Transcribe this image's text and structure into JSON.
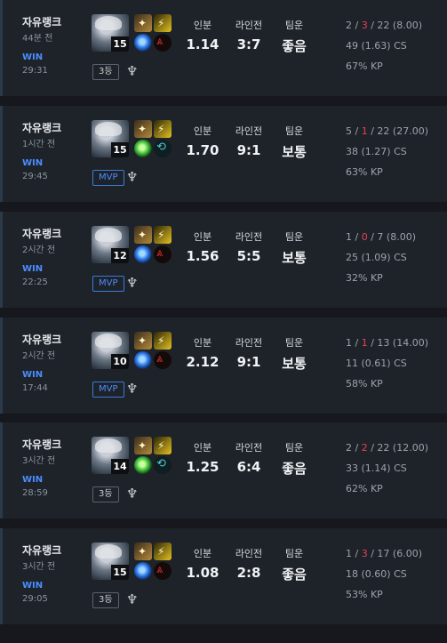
{
  "matches": [
    {
      "queue": "자유랭크",
      "ago": "44분 전",
      "result": "WIN",
      "duration": "29:31",
      "level": "15",
      "badge": "3등",
      "badge_type": "rank",
      "rune2": "red",
      "rune1": "blue",
      "stats": {
        "label1": "인분",
        "value1": "1.14",
        "label2": "라인전",
        "value2": "3:7",
        "label3": "팀운",
        "value3": "좋음"
      },
      "kda": {
        "k": "2",
        "d": "3",
        "a": "22",
        "ratio": "(8.00)"
      },
      "cs": "49 (1.63) CS",
      "kp": "67% KP"
    },
    {
      "queue": "자유랭크",
      "ago": "1시간 전",
      "result": "WIN",
      "duration": "29:45",
      "level": "15",
      "badge": "MVP",
      "badge_type": "mvp",
      "rune2": "teal",
      "rune1": "green",
      "stats": {
        "label1": "인분",
        "value1": "1.70",
        "label2": "라인전",
        "value2": "9:1",
        "label3": "팀운",
        "value3": "보통"
      },
      "kda": {
        "k": "5",
        "d": "1",
        "a": "22",
        "ratio": "(27.00)"
      },
      "cs": "38 (1.27) CS",
      "kp": "63% KP"
    },
    {
      "queue": "자유랭크",
      "ago": "2시간 전",
      "result": "WIN",
      "duration": "22:25",
      "level": "12",
      "badge": "MVP",
      "badge_type": "mvp",
      "rune2": "red",
      "rune1": "blue",
      "stats": {
        "label1": "인분",
        "value1": "1.56",
        "label2": "라인전",
        "value2": "5:5",
        "label3": "팀운",
        "value3": "보통"
      },
      "kda": {
        "k": "1",
        "d": "0",
        "a": "7",
        "ratio": "(8.00)"
      },
      "cs": "25 (1.09) CS",
      "kp": "32% KP"
    },
    {
      "queue": "자유랭크",
      "ago": "2시간 전",
      "result": "WIN",
      "duration": "17:44",
      "level": "10",
      "badge": "MVP",
      "badge_type": "mvp",
      "rune2": "red",
      "rune1": "blue",
      "stats": {
        "label1": "인분",
        "value1": "2.12",
        "label2": "라인전",
        "value2": "9:1",
        "label3": "팀운",
        "value3": "보통"
      },
      "kda": {
        "k": "1",
        "d": "1",
        "a": "13",
        "ratio": "(14.00)"
      },
      "cs": "11 (0.61) CS",
      "kp": "58% KP"
    },
    {
      "queue": "자유랭크",
      "ago": "3시간 전",
      "result": "WIN",
      "duration": "28:59",
      "level": "14",
      "badge": "3등",
      "badge_type": "rank",
      "rune2": "teal",
      "rune1": "green",
      "stats": {
        "label1": "인분",
        "value1": "1.25",
        "label2": "라인전",
        "value2": "6:4",
        "label3": "팀운",
        "value3": "좋음"
      },
      "kda": {
        "k": "2",
        "d": "2",
        "a": "22",
        "ratio": "(12.00)"
      },
      "cs": "33 (1.14) CS",
      "kp": "62% KP"
    },
    {
      "queue": "자유랭크",
      "ago": "3시간 전",
      "result": "WIN",
      "duration": "29:05",
      "level": "15",
      "badge": "3등",
      "badge_type": "rank",
      "rune2": "red",
      "rune1": "blue",
      "stats": {
        "label1": "인분",
        "value1": "1.08",
        "label2": "라인전",
        "value2": "2:8",
        "label3": "팀운",
        "value3": "좋음"
      },
      "kda": {
        "k": "1",
        "d": "3",
        "a": "17",
        "ratio": "(6.00)"
      },
      "cs": "18 (0.60) CS",
      "kp": "53% KP"
    }
  ]
}
